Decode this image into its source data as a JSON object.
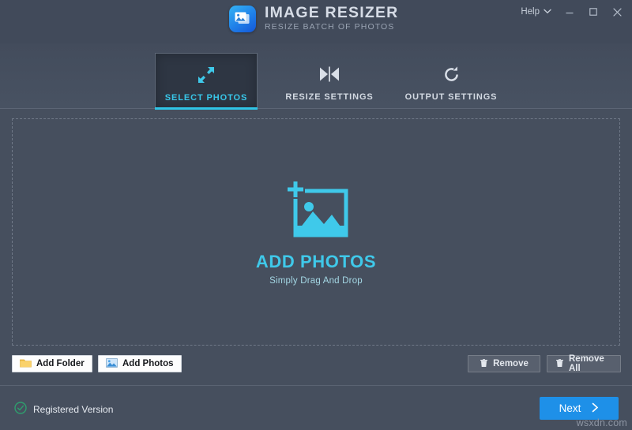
{
  "titlebar": {
    "app_title": "IMAGE RESIZER",
    "app_subtitle": "RESIZE BATCH OF PHOTOS",
    "logo_icon": "photo-stack-icon",
    "help_label": "Help",
    "help_chevron_icon": "chevron-down-icon",
    "minimize_icon": "minimize-icon",
    "maximize_icon": "maximize-icon",
    "close_icon": "close-icon",
    "bg_color": "#414A5A"
  },
  "tabs": [
    {
      "label": "SELECT PHOTOS",
      "icon": "expand-diagonal-arrows-icon",
      "active": true
    },
    {
      "label": "RESIZE SETTINGS",
      "icon": "collapse-horizontal-icon",
      "active": false
    },
    {
      "label": "OUTPUT SETTINGS",
      "icon": "rotate-clockwise-icon",
      "active": false
    }
  ],
  "dropzone": {
    "icon": "add-picture-icon",
    "title": "ADD PHOTOS",
    "subtitle": "Simply Drag And Drop",
    "accent_color": "#3FC9EA"
  },
  "actions": {
    "add_folder_label": "Add Folder",
    "add_folder_icon": "folder-icon",
    "add_photos_label": "Add Photos",
    "add_photos_icon": "picture-icon",
    "remove_label": "Remove",
    "remove_icon": "trash-icon",
    "remove_all_label": "Remove All",
    "remove_all_icon": "trash-icon"
  },
  "statusbar": {
    "registered_label": "Registered Version",
    "registered_icon": "check-circle-icon",
    "registered_color": "#2f9e6e",
    "next_label": "Next",
    "next_icon": "chevron-right-icon",
    "next_color": "#1E90E8"
  },
  "watermark": {
    "text": "wsxdn.com"
  }
}
